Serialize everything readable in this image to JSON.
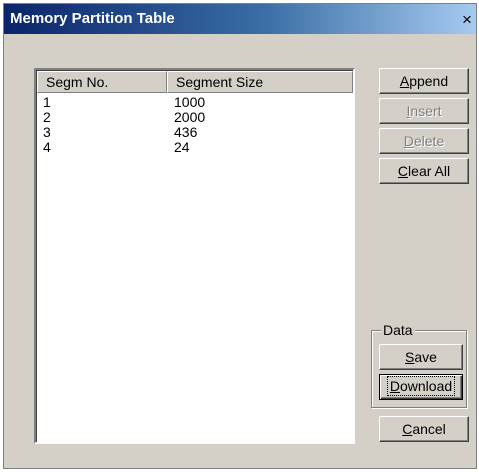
{
  "window": {
    "title": "Memory Partition Table",
    "close_label": "×"
  },
  "list": {
    "columns": [
      "Segm No.",
      "Segment Size"
    ],
    "rows": [
      {
        "no": "1",
        "size": "1000"
      },
      {
        "no": "2",
        "size": "2000"
      },
      {
        "no": "3",
        "size": "436"
      },
      {
        "no": "4",
        "size": "24"
      }
    ]
  },
  "buttons": {
    "append": {
      "mn": "A",
      "rest": "ppend"
    },
    "insert": {
      "mn": "I",
      "rest": "nsert"
    },
    "delete": {
      "mn": "D",
      "rest": "elete"
    },
    "clear_all": {
      "mn": "C",
      "rest": "lear All"
    },
    "save": {
      "mn": "S",
      "rest": "ave"
    },
    "download": {
      "mn": "D",
      "rest": "ownload"
    },
    "cancel": {
      "mn": "C",
      "rest": "ancel"
    }
  },
  "data_group": {
    "title": "Data"
  }
}
